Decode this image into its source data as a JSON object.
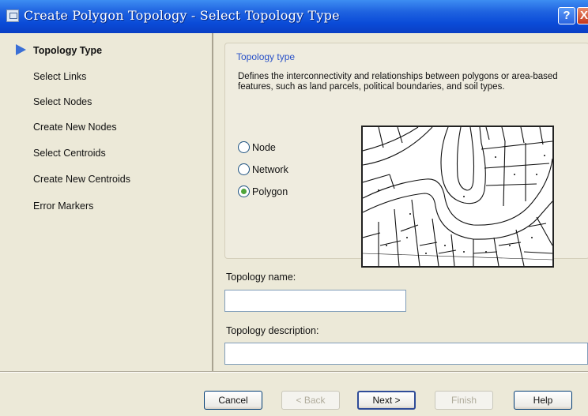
{
  "window": {
    "title": "Create Polygon Topology - Select Topology Type",
    "help_glyph": "?",
    "close_glyph": "X"
  },
  "sidebar": {
    "items": [
      {
        "label": "Topology Type",
        "active": true
      },
      {
        "label": "Select Links"
      },
      {
        "label": "Select Nodes"
      },
      {
        "label": "Create New Nodes"
      },
      {
        "label": "Select Centroids"
      },
      {
        "label": "Create New Centroids"
      },
      {
        "label": "Error Markers"
      }
    ]
  },
  "topology_type": {
    "group_label": "Topology type",
    "description": "Defines the interconnectivity and relationships between polygons or area-based features, such as land parcels, political boundaries, and soil types.",
    "options": [
      {
        "label": "Node",
        "selected": false
      },
      {
        "label": "Network",
        "selected": false
      },
      {
        "label": "Polygon",
        "selected": true
      }
    ]
  },
  "form": {
    "name_label": "Topology name:",
    "name_value": "",
    "description_label": "Topology description:",
    "description_value": ""
  },
  "buttons": {
    "cancel": "Cancel",
    "back": "< Back",
    "next": "Next >",
    "finish": "Finish",
    "help": "Help"
  },
  "colors": {
    "titlebar": "#0a4bd8",
    "accent_label": "#2a52c8",
    "nav_arrow": "#3a6fd6",
    "radio_selected": "#4fa53b"
  }
}
